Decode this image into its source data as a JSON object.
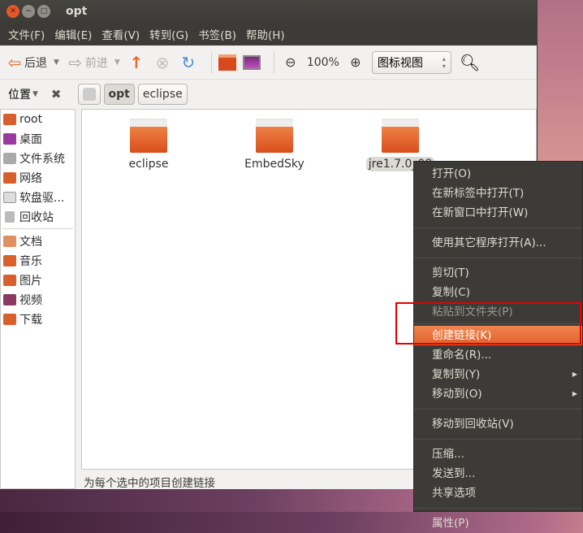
{
  "window": {
    "title": "opt"
  },
  "menubar": [
    "文件(F)",
    "编辑(E)",
    "查看(V)",
    "转到(G)",
    "书签(B)",
    "帮助(H)"
  ],
  "toolbar": {
    "back": "后退",
    "forward": "前进",
    "zoom": "100%",
    "view_mode": "图标视图"
  },
  "location": {
    "label": "位置",
    "path": [
      "opt",
      "eclipse"
    ]
  },
  "sidebar": {
    "places": [
      "root",
      "桌面",
      "文件系统",
      "网络",
      "软盘驱...",
      "回收站"
    ],
    "bookmarks": [
      "文档",
      "音乐",
      "图片",
      "视频",
      "下载"
    ]
  },
  "files": [
    "eclipse",
    "EmbedSky",
    "jre1.7.0_08"
  ],
  "context_menu": {
    "groups": [
      [
        "打开(O)",
        "在新标签中打开(T)",
        "在新窗口中打开(W)"
      ],
      [
        "使用其它程序打开(A)..."
      ],
      [
        "剪切(T)",
        "复制(C)",
        "粘贴到文件夹(P)"
      ],
      [
        "创建链接(K)",
        "重命名(R)...",
        "复制到(Y)",
        "移动到(O)"
      ],
      [
        "移动到回收站(V)"
      ],
      [
        "压缩...",
        "发送到...",
        "共享选项"
      ],
      [
        "属性(P)"
      ]
    ],
    "highlighted": "创建链接(K)"
  },
  "status": "为每个选中的项目创建链接",
  "colors": {
    "accent": "#e0602a",
    "highlight_box": "#e60000"
  }
}
